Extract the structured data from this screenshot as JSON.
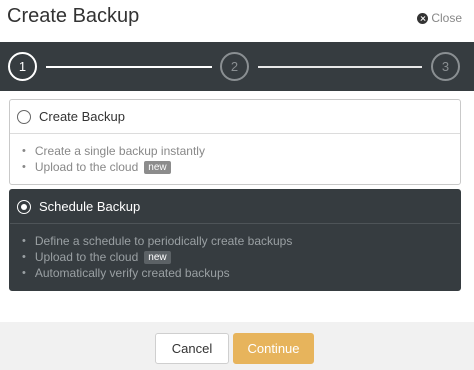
{
  "dialog": {
    "title": "Create Backup",
    "close_label": "Close"
  },
  "stepper": {
    "steps": [
      "1",
      "2",
      "3"
    ],
    "active_step": 1
  },
  "options": [
    {
      "label": "Create Backup",
      "selected": false,
      "features": [
        {
          "text": "Create a single backup instantly",
          "badge": ""
        },
        {
          "text": "Upload to the cloud",
          "badge": "new"
        }
      ]
    },
    {
      "label": "Schedule Backup",
      "selected": true,
      "features": [
        {
          "text": "Define a schedule to periodically create backups",
          "badge": ""
        },
        {
          "text": "Upload to the cloud",
          "badge": "new"
        },
        {
          "text": "Automatically verify created backups",
          "badge": ""
        }
      ]
    }
  ],
  "footer": {
    "cancel_label": "Cancel",
    "continue_label": "Continue"
  },
  "colors": {
    "dark_panel": "#363c40",
    "accent": "#e7b45c"
  }
}
